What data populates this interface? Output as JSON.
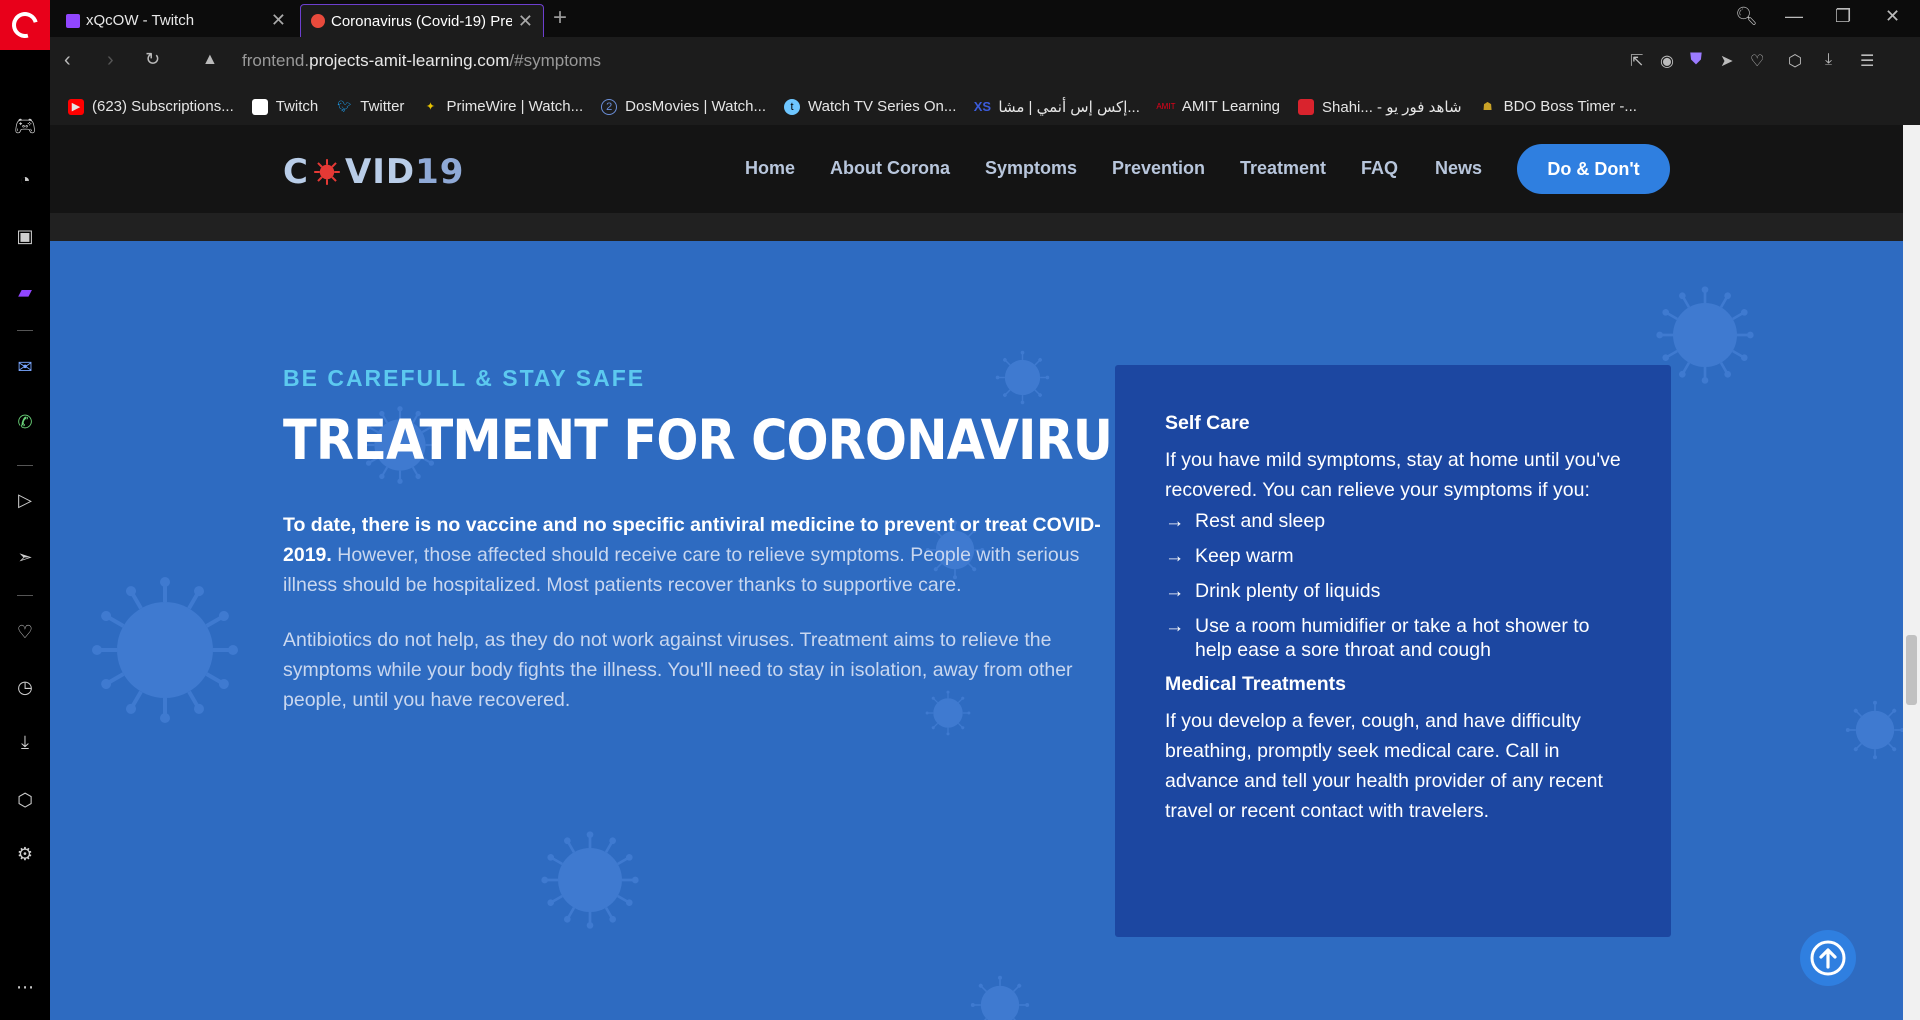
{
  "browser": {
    "tabs": [
      {
        "title": "xQcOW - Twitch",
        "active": false
      },
      {
        "title": "Coronavirus (Covid-19) Pre",
        "active": true
      }
    ],
    "url_domain_pre": "frontend.",
    "url_domain_main": "projects-amit-learning.com",
    "url_path": "/#symptoms",
    "bookmarks": [
      {
        "label": "(623) Subscriptions...",
        "icon": "youtube-icon",
        "color": "#ff0000"
      },
      {
        "label": "Twitch",
        "icon": "page-icon",
        "color": "#ffffff"
      },
      {
        "label": "Twitter",
        "icon": "twitter-icon",
        "color": "#1da1f2"
      },
      {
        "label": "PrimeWire | Watch...",
        "icon": "primewire-icon",
        "color": "#e6c200"
      },
      {
        "label": "DosMovies | Watch...",
        "icon": "dosmovies-icon",
        "color": "#3b82f6"
      },
      {
        "label": "Watch TV Series On...",
        "icon": "tvseries-icon",
        "color": "#6ec6ff"
      },
      {
        "label": "إكس إس أنمي | مشا...",
        "icon": "xs-icon",
        "color": "#3b5bdb"
      },
      {
        "label": "AMIT Learning",
        "icon": "amit-icon",
        "color": "#e8001a"
      },
      {
        "label": "Shahi... - شاهد فور يو",
        "icon": "shahid-icon",
        "color": "#d9232d"
      },
      {
        "label": "BDO Boss Timer -...",
        "icon": "bdo-icon",
        "color": "#c9a227"
      }
    ]
  },
  "site": {
    "logo_pre": "C",
    "logo_mid": "VID",
    "logo_num": "19",
    "nav": [
      "Home",
      "About Corona",
      "Symptoms",
      "Prevention",
      "Treatment",
      "FAQ",
      "News"
    ],
    "cta": "Do & Don't"
  },
  "section": {
    "kicker": "BE CAREFULL & STAY SAFE",
    "heading": "TREATMENT FOR CORONAVIRUS",
    "para1_bold": "To date, there is no vaccine and no specific antiviral medicine to prevent or treat COVID-2019.",
    "para1_rest": " However, those affected should receive care to relieve symptoms. People with serious illness should be hospitalized. Most patients recover thanks to supportive care.",
    "para2": "Antibiotics do not help, as they do not work against viruses. Treatment aims to relieve the symptoms while your body fights the illness. You'll need to stay in isolation, away from other people, until you have recovered."
  },
  "card": {
    "self_care_title": "Self Care",
    "self_care_text": "If you have mild symptoms, stay at home until you've recovered. You can relieve your symptoms if you:",
    "items": [
      "Rest and sleep",
      "Keep warm",
      "Drink plenty of liquids",
      "Use a room humidifier or take a hot shower to help ease a sore throat and cough"
    ],
    "medical_title": "Medical Treatments",
    "medical_text": "If you develop a fever, cough, and have difficulty breathing, promptly seek medical care. Call in advance and tell your health provider of any recent travel or recent contact with travelers."
  },
  "colors": {
    "page_bg": "#2e6bc1",
    "card_bg": "#1c47a1",
    "accent": "#2f7fe0",
    "kicker": "#5cc9ef"
  }
}
